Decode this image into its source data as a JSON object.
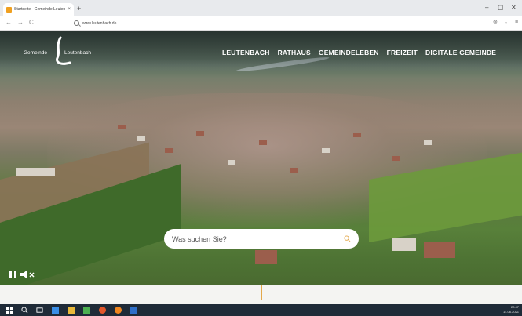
{
  "browser": {
    "tab_title": "Startseite - Gemeinde Leutenbach",
    "tab_close": "×",
    "new_tab": "+",
    "window_controls": {
      "minimize": "–",
      "maximize": "▢",
      "close": "✕"
    },
    "nav": {
      "back": "←",
      "forward": "→",
      "reload": "C"
    },
    "address": "www.leutenbach.de"
  },
  "site": {
    "logo_left": "Gemeinde",
    "logo_right": "Leutenbach",
    "nav_items": [
      "LEUTENBACH",
      "RATHAUS",
      "GEMEINDELEBEN",
      "FREIZEIT",
      "DIGITALE GEMEINDE"
    ],
    "search_placeholder": "Was suchen Sie?"
  },
  "taskbar": {
    "clock_time": "20:47",
    "clock_date": "14.06.2021"
  },
  "colors": {
    "accent": "#e3a84b",
    "taskbar": "#1f2b38"
  }
}
